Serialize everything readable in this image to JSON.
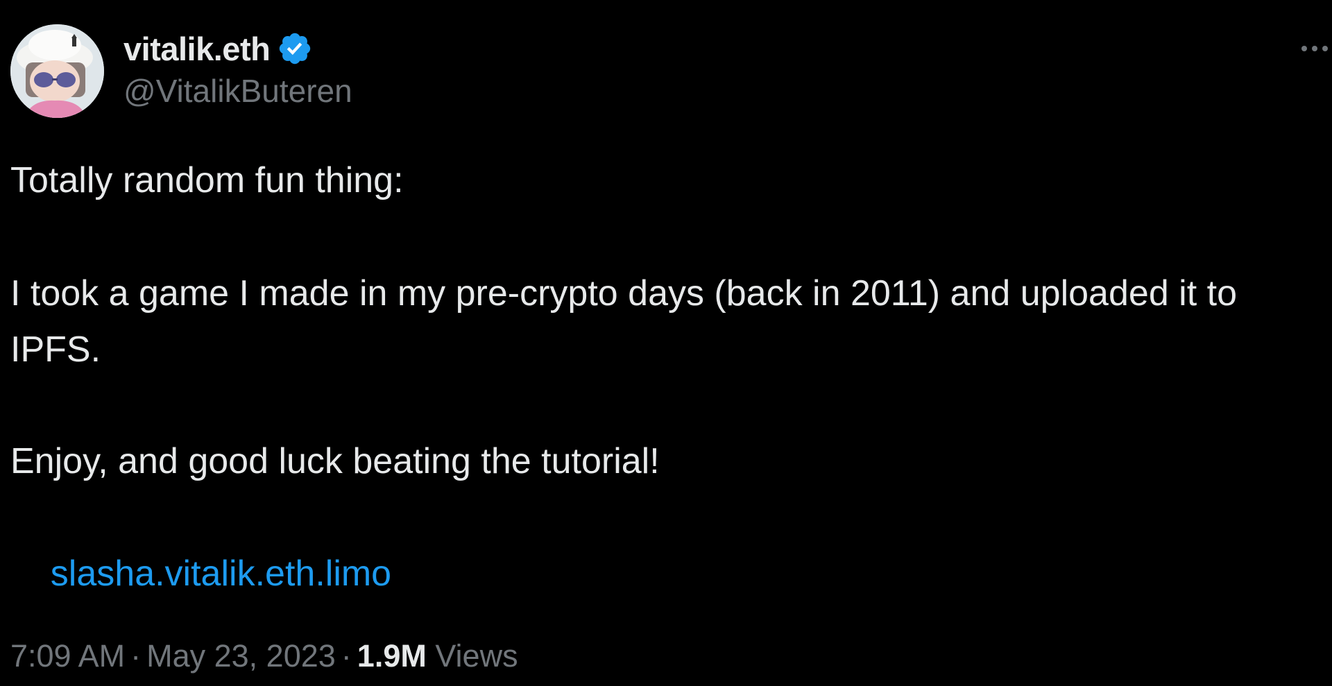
{
  "author": {
    "display_name": "vitalik.eth",
    "handle": "@VitalikButeren",
    "verified": true,
    "verified_badge_color": "#1d9bf0",
    "avatar_icon": "avatar-image"
  },
  "tweet": {
    "paragraphs": [
      "Totally random fun thing:",
      "I took a game I made in my pre-crypto days (back in 2011) and uploaded it to IPFS.",
      "Enjoy, and good luck beating the tutorial!"
    ],
    "link_text": "slasha.vitalik.eth.limo"
  },
  "meta": {
    "time": "7:09 AM",
    "separator": "·",
    "date": "May 23, 2023",
    "views_count": "1.9M",
    "views_label": "Views"
  },
  "more_icon": "more-horizontal-icon",
  "colors": {
    "background": "#000000",
    "text": "#e7e9ea",
    "secondary": "#71767b",
    "link": "#1d9bf0"
  }
}
